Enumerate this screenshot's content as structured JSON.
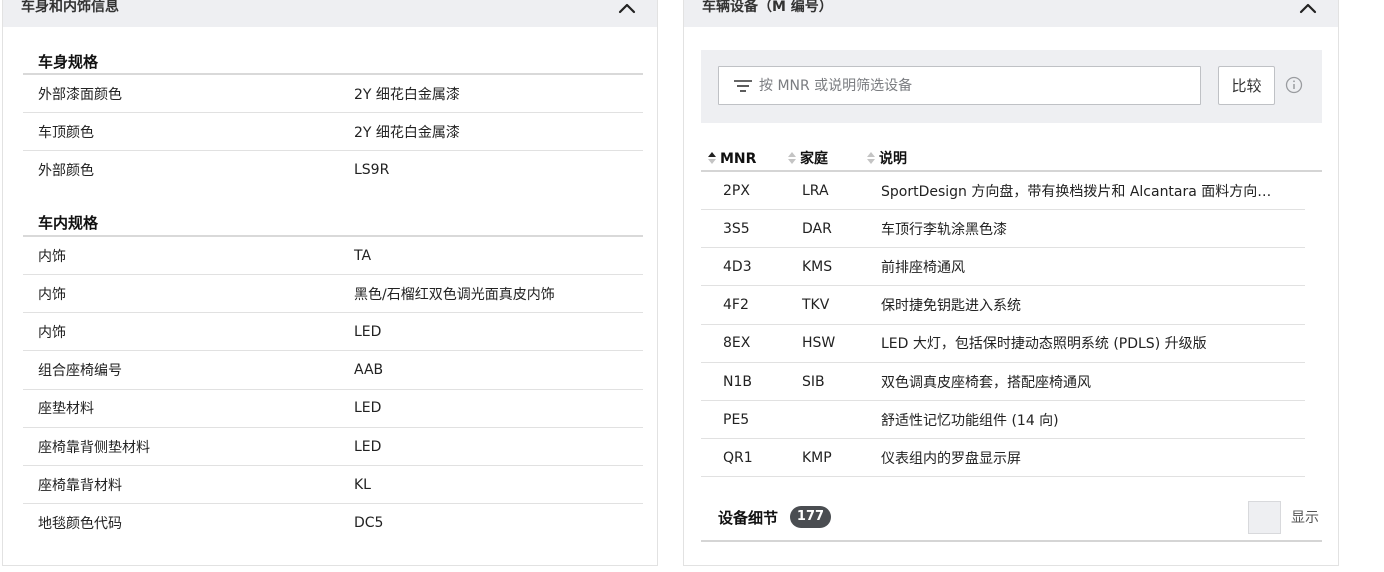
{
  "body_interior": {
    "title": "车身和内饰信息",
    "body_section_title": "车身规格",
    "body_specs": [
      {
        "label": "外部漆面颜色",
        "value": "2Y 细花白金属漆"
      },
      {
        "label": "车顶颜色",
        "value": "2Y 细花白金属漆"
      },
      {
        "label": "外部颜色",
        "value": "LS9R"
      }
    ],
    "interior_section_title": "车内规格",
    "interior_specs": [
      {
        "label": "内饰",
        "value": "TA"
      },
      {
        "label": "内饰",
        "value": "黑色/石榴红双色调光面真皮内饰"
      },
      {
        "label": "内饰",
        "value": "LED"
      },
      {
        "label": "组合座椅编号",
        "value": "AAB"
      },
      {
        "label": "座垫材料",
        "value": "LED"
      },
      {
        "label": "座椅靠背侧垫材料",
        "value": "LED"
      },
      {
        "label": "座椅靠背材料",
        "value": "KL"
      },
      {
        "label": "地毯颜色代码",
        "value": "DC5"
      }
    ]
  },
  "equipment": {
    "title": "车辆设备（M 编号）",
    "filter_placeholder": "按 MNR 或说明筛选设备",
    "compare_label": "比较",
    "columns": {
      "mnr": "MNR",
      "family": "家庭",
      "description": "说明"
    },
    "rows": [
      {
        "mnr": "2PX",
        "family": "LRA",
        "description": "SportDesign 方向盘，带有换档拨片和 Alcantara 面料方向…"
      },
      {
        "mnr": "3S5",
        "family": "DAR",
        "description": "车顶行李轨涂黑色漆"
      },
      {
        "mnr": "4D3",
        "family": "KMS",
        "description": "前排座椅通风"
      },
      {
        "mnr": "4F2",
        "family": "TKV",
        "description": "保时捷免钥匙进入系统"
      },
      {
        "mnr": "8EX",
        "family": "HSW",
        "description": "LED 大灯，包括保时捷动态照明系统 (PDLS) 升级版"
      },
      {
        "mnr": "N1B",
        "family": "SIB",
        "description": "双色调真皮座椅套，搭配座椅通风"
      },
      {
        "mnr": "PE5",
        "family": "",
        "description": "舒适性记忆功能组件 (14 向)"
      },
      {
        "mnr": "QR1",
        "family": "KMP",
        "description": "仪表组内的罗盘显示屏"
      }
    ],
    "details_label": "设备细节",
    "details_count": "177",
    "show_label": "显示"
  },
  "icons": {
    "collapse": "chevron-up-icon",
    "filter": "filter-icon",
    "info": "info-icon",
    "sort": "sort-icon"
  },
  "colors": {
    "header_bg": "#eeeff2",
    "badge_bg": "#4a4d51",
    "border": "#e1e1e1"
  }
}
